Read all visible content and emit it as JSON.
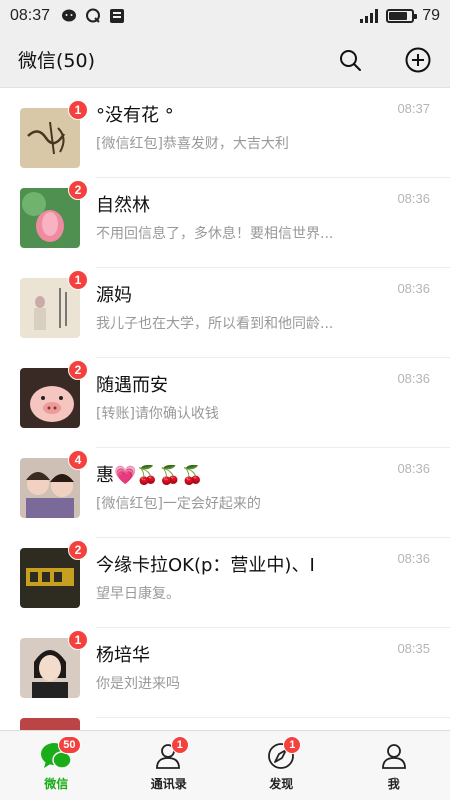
{
  "status_bar": {
    "time": "08:37",
    "left_icons": [
      "wechat-status-icon",
      "qq-status-icon",
      "app-status-icon"
    ],
    "battery_level": 79,
    "battery_text": "79"
  },
  "header": {
    "title": "微信(50)",
    "search_icon": "search-icon",
    "add_icon": "plus-circle-icon"
  },
  "chats": [
    {
      "name": "°没有花 °",
      "preview": "[微信红包]恭喜发财，大吉大利",
      "time": "08:37",
      "badge": "1",
      "avatar_color": "#d8c7a6"
    },
    {
      "name": "自然林",
      "preview": "不用回信息了，多休息！要相信世界...",
      "time": "08:36",
      "badge": "2",
      "avatar_color": "#5a9a5a"
    },
    {
      "name": "源妈",
      "preview": "我儿子也在大学，所以看到和他同龄...",
      "time": "08:36",
      "badge": "1",
      "avatar_color": "#e8e0d0"
    },
    {
      "name": "随遇而安",
      "preview": "[转账]请你确认收钱",
      "time": "08:36",
      "badge": "2",
      "avatar_color": "#e8b8b0"
    },
    {
      "name": "惠💗🍒🍒🍒",
      "preview": "[微信红包]一定会好起来的",
      "time": "08:36",
      "badge": "4",
      "avatar_color": "#c9a7a0"
    },
    {
      "name": "今缘卡拉OK(p：营业中)、I",
      "preview": "望早日康复。",
      "time": "08:36",
      "badge": "2",
      "avatar_color": "#3b3b2e"
    },
    {
      "name": "杨培华",
      "preview": "你是刘进来吗",
      "time": "08:35",
      "badge": "1",
      "avatar_color": "#c8b6a8"
    }
  ],
  "tabs": [
    {
      "label": "微信",
      "icon": "chat-bubble-icon",
      "badge": "50",
      "active": true
    },
    {
      "label": "通讯录",
      "icon": "contacts-icon",
      "badge": "1",
      "active": false
    },
    {
      "label": "发现",
      "icon": "compass-icon",
      "badge": "1",
      "active": false
    },
    {
      "label": "我",
      "icon": "person-icon",
      "badge": "",
      "active": false
    }
  ],
  "colors": {
    "accent_green": "#1aad19",
    "badge_red": "#f5413d",
    "header_bg": "#efefef"
  }
}
